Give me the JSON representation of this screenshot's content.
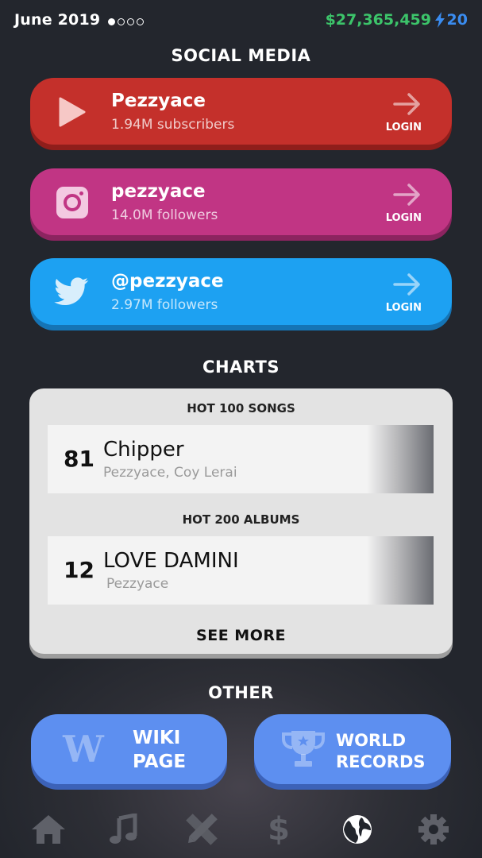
{
  "status": {
    "date": "June 2019",
    "money": "$27,365,459",
    "energy": "20"
  },
  "social": {
    "title": "SOCIAL MEDIA",
    "youtube": {
      "handle": "Pezzyace",
      "count": "1.94M subscribers",
      "login": "LOGIN",
      "color": "#c4302b",
      "icon": "play-icon"
    },
    "instagram": {
      "handle": "pezzyace",
      "count": "14.0M followers",
      "login": "LOGIN",
      "color": "#c13584",
      "icon": "instagram-icon"
    },
    "twitter": {
      "handle": "@pezzyace",
      "count": "2.97M followers",
      "login": "LOGIN",
      "color": "#1da1f2",
      "icon": "twitter-bird-icon"
    }
  },
  "charts": {
    "title": "CHARTS",
    "songs_header": "HOT 100 SONGS",
    "song": {
      "rank": "81",
      "title": "Chipper",
      "artist": "Pezzyace, Coy Lerai"
    },
    "albums_header": "HOT 200 ALBUMS",
    "album": {
      "rank": "12",
      "title": "LOVE DAMINI",
      "artist": "Pezzyace"
    },
    "see_more": "SEE MORE"
  },
  "other": {
    "title": "OTHER",
    "wiki_line1": "WIKI",
    "wiki_line2": "PAGE",
    "records_line1": "WORLD",
    "records_line2": "RECORDS",
    "wiki_icon_glyph": "W"
  },
  "nav": {
    "items": [
      "home-icon",
      "music-note-icon",
      "pencil-ruler-icon",
      "dollar-icon",
      "globe-icon",
      "gear-icon"
    ],
    "active": "globe-icon",
    "dollar_glyph": "$"
  }
}
